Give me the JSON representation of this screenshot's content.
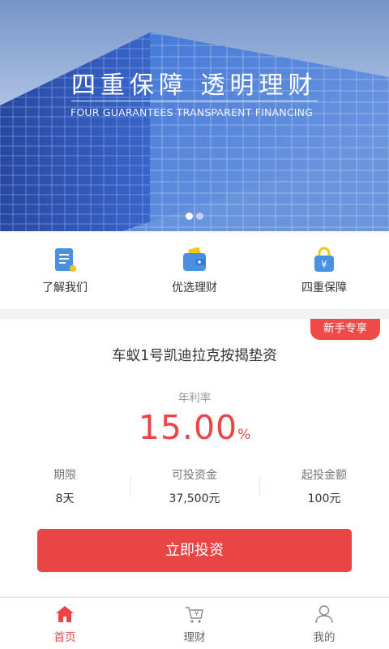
{
  "banner": {
    "title": "四重保障  透明理财",
    "subtitle": "FOUR GUARANTEES TRANSPARENT FINANCING",
    "slides": 2,
    "active_slide": 1
  },
  "quicknav": [
    {
      "label": "了解我们",
      "icon": "document-icon"
    },
    {
      "label": "优选理财",
      "icon": "wallet-icon"
    },
    {
      "label": "四重保障",
      "icon": "yuan-lock-icon"
    }
  ],
  "product": {
    "badge": "新手专享",
    "name": "车蚁1号凯迪拉克按揭垫资",
    "rate_label": "年利率",
    "rate_value": "15.00",
    "rate_unit": "%",
    "stats": [
      {
        "label": "期限",
        "value": "8天"
      },
      {
        "label": "可投资金",
        "value": "37,500元"
      },
      {
        "label": "起投金额",
        "value": "100元"
      }
    ],
    "button": "立即投资"
  },
  "tabs": [
    {
      "label": "首页",
      "icon": "home-icon",
      "active": true
    },
    {
      "label": "理财",
      "icon": "cart-yuan-icon",
      "active": false
    },
    {
      "label": "我的",
      "icon": "user-icon",
      "active": false
    }
  ],
  "colors": {
    "accent_red": "#e94545",
    "icon_blue": "#4a90e2",
    "icon_yellow": "#f5c518"
  }
}
